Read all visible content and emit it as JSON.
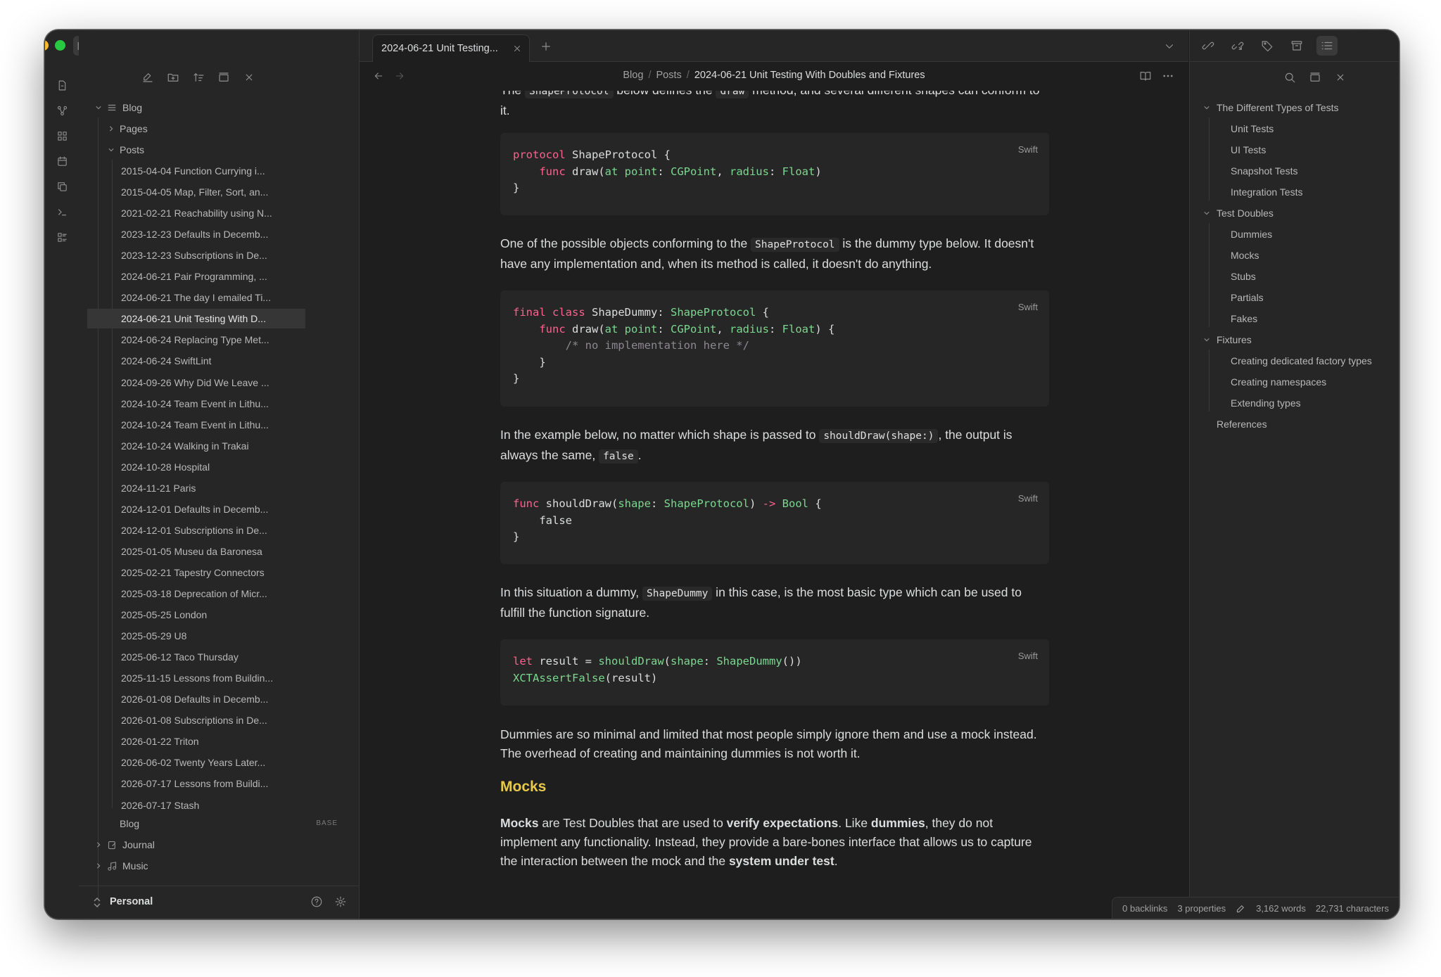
{
  "colors": {
    "traffic_close": "#ff5f57",
    "traffic_minimize": "#febc2e",
    "traffic_zoom": "#28c840",
    "heading": "#e8c94a",
    "keyword": "#fc618d",
    "type": "#7bd88f"
  },
  "left_toolbar_icons": [
    "folder-icon",
    "search-icon",
    "bookmark-icon",
    "sidebar-toggle-icon"
  ],
  "ribbon_icons": [
    "file-icon",
    "graph-icon",
    "blocks-icon",
    "calendar-icon",
    "copy-icon",
    "terminal-icon",
    "list-icon"
  ],
  "explorer_actions": [
    "new-note-icon",
    "new-folder-icon",
    "sort-icon",
    "collapse-icon",
    "close-icon"
  ],
  "tab": {
    "title": "2024-06-21 Unit Testing..."
  },
  "breadcrumb": {
    "part1": "Blog",
    "sep": "/",
    "part2": "Posts",
    "current": "2024-06-21 Unit Testing With Doubles and Fixtures"
  },
  "tree": {
    "blog": "Blog",
    "pages": "Pages",
    "posts": "Posts",
    "post_items": [
      "2015-04-04 Function Currying i...",
      "2015-04-05 Map, Filter, Sort, an...",
      "2021-02-21 Reachability using N...",
      "2023-12-23 Defaults in Decemb...",
      "2023-12-23 Subscriptions in De...",
      "2024-06-21 Pair Programming, ...",
      "2024-06-21 The day I emailed Ti...",
      "2024-06-21 Unit Testing With D...",
      "2024-06-24 Replacing Type Met...",
      "2024-06-24 SwiftLint",
      "2024-09-26 Why Did We Leave ...",
      "2024-10-24 Team Event in Lithu...",
      "2024-10-24 Team Event in Lithu...",
      "2024-10-24 Walking in Trakai",
      "2024-10-28 Hospital",
      "2024-11-21 Paris",
      "2024-12-01 Defaults in Decemb...",
      "2024-12-01 Subscriptions in De...",
      "2025-01-05 Museu da Baronesa",
      "2025-02-21 Tapestry Connectors",
      "2025-03-18 Deprecation of Micr...",
      "2025-05-25 London",
      "2025-05-29 U8",
      "2025-06-12 Taco Thursday",
      "2025-11-15 Lessons from Buildin...",
      "2026-01-08 Defaults in Decemb...",
      "2026-01-08 Subscriptions in De...",
      "2026-01-22 Triton",
      "2026-06-02 Twenty Years Later...",
      "2026-07-17 Lessons from Buildi...",
      "2026-07-17 Stash"
    ],
    "blog_base": "Blog",
    "base_badge": "BASE",
    "journal": "Journal",
    "music": "Music"
  },
  "vault": {
    "name": "Personal"
  },
  "doc": {
    "p0_a": "The ",
    "p0_code1": "ShapeProtocol",
    "p0_b": " below defines the ",
    "p0_code2": "draw",
    "p0_c": " method, and several different shapes can conform to it.",
    "code1_lang": "Swift",
    "p1_a": "One of the possible objects conforming to the ",
    "p1_code": "ShapeProtocol",
    "p1_b": " is the dummy type below. It doesn't have any implementation and, when its method is called, it doesn't do anything.",
    "code2_lang": "Swift",
    "p2_a": "In the example below, no matter which shape is passed to ",
    "p2_code1": "shouldDraw(shape:)",
    "p2_b": ", the output is always the same, ",
    "p2_code2": "false",
    "p2_c": ".",
    "code3_lang": "Swift",
    "p3_a": "In this situation a dummy, ",
    "p3_code": "ShapeDummy",
    "p3_b": " in this case, is the most basic type which can be used to fulfill the function signature.",
    "code4_lang": "Swift",
    "p4": "Dummies are so minimal and limited that most people simply ignore them and use a mock instead. The overhead of creating and maintaining dummies is not worth it.",
    "h_mocks": "Mocks",
    "p5_b1": "Mocks",
    "p5_a": " are Test Doubles that are used to ",
    "p5_b2": "verify expectations",
    "p5_c": ". Like ",
    "p5_b3": "dummies",
    "p5_d": ", they do not implement any functionality. Instead, they provide a bare-bones interface that allows us to capture the interaction between the mock and the ",
    "p5_b4": "system under test",
    "p5_e": "."
  },
  "outline": {
    "h1": "The Different Types of Tests",
    "h1_items": [
      "Unit Tests",
      "UI Tests",
      "Snapshot Tests",
      "Integration Tests"
    ],
    "h2": "Test Doubles",
    "h2_items": [
      "Dummies",
      "Mocks",
      "Stubs",
      "Partials",
      "Fakes"
    ],
    "h3": "Fixtures",
    "h3_items": [
      "Creating dedicated factory types",
      "Creating namespaces",
      "Extending types"
    ],
    "h4": "References"
  },
  "status": {
    "backlinks": "0 backlinks",
    "properties": "3 properties",
    "words": "3,162 words",
    "characters": "22,731 characters"
  }
}
